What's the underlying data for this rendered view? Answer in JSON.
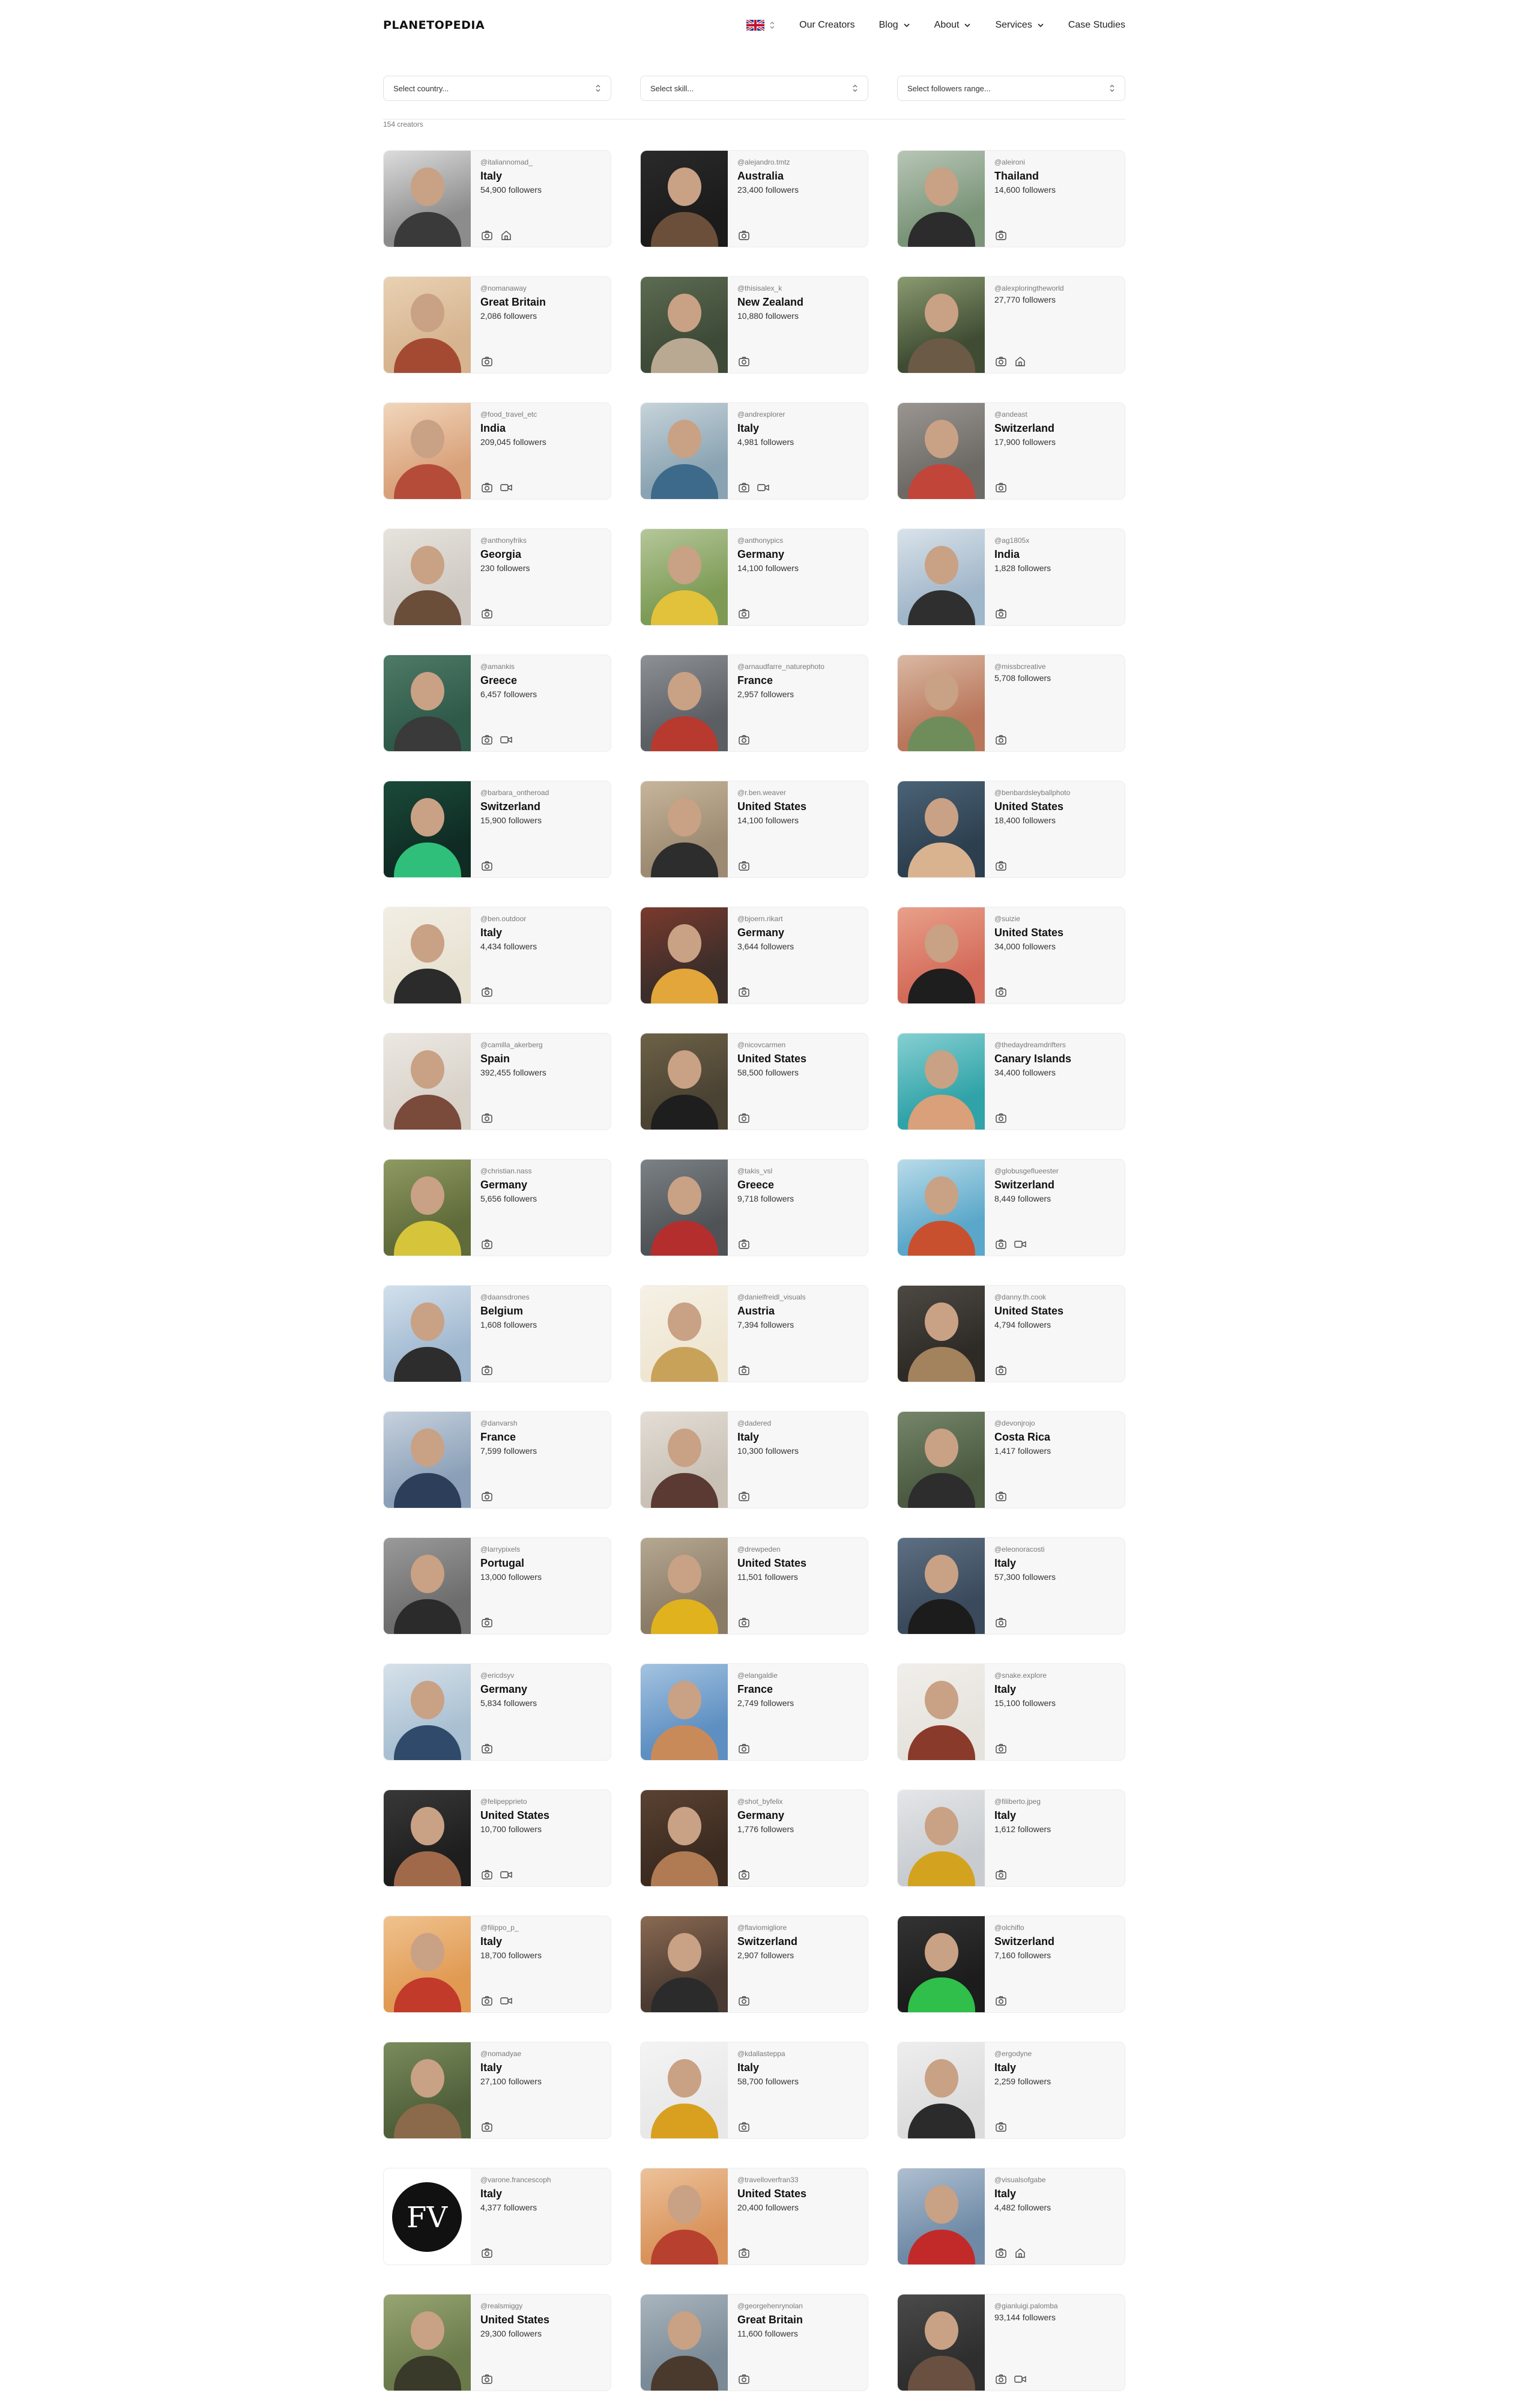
{
  "header": {
    "logo": "PLANETOPEDIA",
    "nav": [
      "Our Creators",
      "Blog",
      "About",
      "Services",
      "Case Studies"
    ]
  },
  "filters": {
    "country": "Select country...",
    "skill": "Select skill...",
    "followers": "Select followers range..."
  },
  "results_count": "154 creators",
  "creators": [
    {
      "handle": "@italiannomad_",
      "country": "Italy",
      "followers": "54,900 followers",
      "icons": [
        "camera-icon",
        "home-icon"
      ],
      "tones": [
        "#8c8c8c",
        "#3a3a3a",
        "#dcdcdc"
      ]
    },
    {
      "handle": "@alejandro.tmtz",
      "country": "Australia",
      "followers": "23,400 followers",
      "icons": [
        "camera-icon"
      ],
      "tones": [
        "#1b1b1b",
        "#6b4f3a",
        "#2a2a2a"
      ]
    },
    {
      "handle": "@aleironi",
      "country": "Thailand",
      "followers": "14,600 followers",
      "icons": [
        "camera-icon"
      ],
      "tones": [
        "#7a9478",
        "#2c2c2c",
        "#b7c6b6"
      ]
    },
    {
      "handle": "@nomanaway",
      "country": "Great Britain",
      "followers": "2,086 followers",
      "icons": [
        "camera-icon"
      ],
      "tones": [
        "#d6b48f",
        "#a54a32",
        "#e9d1b3"
      ]
    },
    {
      "handle": "@thisisalex_k",
      "country": "New Zealand",
      "followers": "10,880 followers",
      "icons": [
        "camera-icon"
      ],
      "tones": [
        "#3d4a37",
        "#b9a892",
        "#5c6b52"
      ]
    },
    {
      "handle": "@alexploringtheworld",
      "country": "",
      "followers": "27,770 followers",
      "icons": [
        "camera-icon",
        "home-icon"
      ],
      "tones": [
        "#3f4c33",
        "#6b5a45",
        "#8a9a70"
      ]
    },
    {
      "handle": "@food_travel_etc",
      "country": "India",
      "followers": "209,045 followers",
      "icons": [
        "camera-icon",
        "video-icon"
      ],
      "tones": [
        "#d9a17a",
        "#b54c3a",
        "#f1d6bb"
      ]
    },
    {
      "handle": "@andrexplorer",
      "country": "Italy",
      "followers": "4,981 followers",
      "icons": [
        "camera-icon",
        "video-icon"
      ],
      "tones": [
        "#8aa3b2",
        "#3d6a8a",
        "#c6d3da"
      ]
    },
    {
      "handle": "@andeast",
      "country": "Switzerland",
      "followers": "17,900 followers",
      "icons": [
        "camera-icon"
      ],
      "tones": [
        "#6d6a66",
        "#c2453a",
        "#9a9590"
      ]
    },
    {
      "handle": "@anthonyfriks",
      "country": "Georgia",
      "followers": "230 followers",
      "icons": [
        "camera-icon"
      ],
      "tones": [
        "#cfcac3",
        "#6a4e3a",
        "#e6e2dc"
      ]
    },
    {
      "handle": "@anthonypics",
      "country": "Germany",
      "followers": "14,100 followers",
      "icons": [
        "camera-icon"
      ],
      "tones": [
        "#7d9b55",
        "#e1c23a",
        "#b5c79a"
      ]
    },
    {
      "handle": "@ag1805x",
      "country": "India",
      "followers": "1,828 followers",
      "icons": [
        "camera-icon"
      ],
      "tones": [
        "#a0b6c9",
        "#2f2f2f",
        "#d9e2ea"
      ]
    },
    {
      "handle": "@amankis",
      "country": "Greece",
      "followers": "6,457 followers",
      "icons": [
        "camera-icon",
        "video-icon"
      ],
      "tones": [
        "#2f5a4a",
        "#3a3a3a",
        "#4e7a66"
      ]
    },
    {
      "handle": "@arnaudfarre_naturephoto",
      "country": "France",
      "followers": "2,957 followers",
      "icons": [
        "camera-icon"
      ],
      "tones": [
        "#5b5f63",
        "#b8392e",
        "#8d9196"
      ]
    },
    {
      "handle": "@missbcreative",
      "country": "",
      "followers": "5,708 followers",
      "icons": [
        "camera-icon"
      ],
      "tones": [
        "#b9765a",
        "#6f8d5a",
        "#d9b8a3"
      ]
    },
    {
      "handle": "@barbara_ontheroad",
      "country": "Switzerland",
      "followers": "15,900 followers",
      "icons": [
        "camera-icon"
      ],
      "tones": [
        "#0f2b23",
        "#2fbf7a",
        "#1b4a3a"
      ]
    },
    {
      "handle": "@r.ben.weaver",
      "country": "United States",
      "followers": "14,100 followers",
      "icons": [
        "camera-icon"
      ],
      "tones": [
        "#9c8a72",
        "#2d2d2d",
        "#c7b59b"
      ]
    },
    {
      "handle": "@benbardsleyballphoto",
      "country": "United States",
      "followers": "18,400 followers",
      "icons": [
        "camera-icon"
      ],
      "tones": [
        "#2c3f4f",
        "#d9b38f",
        "#4b6376"
      ]
    },
    {
      "handle": "@ben.outdoor",
      "country": "Italy",
      "followers": "4,434 followers",
      "icons": [
        "camera-icon"
      ],
      "tones": [
        "#e8e2d2",
        "#2b2b2b",
        "#f2eee4"
      ]
    },
    {
      "handle": "@bjoern.rikart",
      "country": "Germany",
      "followers": "3,644 followers",
      "icons": [
        "camera-icon"
      ],
      "tones": [
        "#3a2d2a",
        "#e2a63a",
        "#7a3a2e"
      ]
    },
    {
      "handle": "@suizie",
      "country": "United States",
      "followers": "34,000 followers",
      "icons": [
        "camera-icon"
      ],
      "tones": [
        "#d46b5a",
        "#1e1e1e",
        "#e8a08a"
      ]
    },
    {
      "handle": "@camilla_akerberg",
      "country": "Spain",
      "followers": "392,455 followers",
      "icons": [
        "camera-icon"
      ],
      "tones": [
        "#d8d2c9",
        "#7a4a3a",
        "#ece8e2"
      ]
    },
    {
      "handle": "@nicovcarmen",
      "country": "United States",
      "followers": "58,500 followers",
      "icons": [
        "camera-icon"
      ],
      "tones": [
        "#4a4232",
        "#1e1e1e",
        "#6d6248"
      ]
    },
    {
      "handle": "@thedaydreamdrifters",
      "country": "Canary Islands",
      "followers": "34,400 followers",
      "icons": [
        "camera-icon"
      ],
      "tones": [
        "#2fa3a8",
        "#d9a07a",
        "#86cfd1"
      ]
    },
    {
      "handle": "@christian.nass",
      "country": "Germany",
      "followers": "5,656 followers",
      "icons": [
        "camera-icon"
      ],
      "tones": [
        "#5f6b3a",
        "#d6c43a",
        "#8f9a62"
      ]
    },
    {
      "handle": "@takis_vsl",
      "country": "Greece",
      "followers": "9,718 followers",
      "icons": [
        "camera-icon"
      ],
      "tones": [
        "#4f5356",
        "#b52e2e",
        "#7c8185"
      ]
    },
    {
      "handle": "@globusgeflueester",
      "country": "Switzerland",
      "followers": "8,449 followers",
      "icons": [
        "camera-icon",
        "video-icon"
      ],
      "tones": [
        "#5aa7c9",
        "#c9502e",
        "#b9dbe9"
      ]
    },
    {
      "handle": "@daansdrones",
      "country": "Belgium",
      "followers": "1,608 followers",
      "icons": [
        "camera-icon"
      ],
      "tones": [
        "#9fb7cf",
        "#2d2d2d",
        "#d2e0ec"
      ]
    },
    {
      "handle": "@danielfreidl_visuals",
      "country": "Austria",
      "followers": "7,394 followers",
      "icons": [
        "camera-icon"
      ],
      "tones": [
        "#efe6d2",
        "#c9a25a",
        "#f6f1e6"
      ]
    },
    {
      "handle": "@danny.th.cook",
      "country": "United States",
      "followers": "4,794 followers",
      "icons": [
        "camera-icon"
      ],
      "tones": [
        "#2e2b27",
        "#a3825e",
        "#4d4842"
      ]
    },
    {
      "handle": "@danvarsh",
      "country": "France",
      "followers": "7,599 followers",
      "icons": [
        "camera-icon"
      ],
      "tones": [
        "#8ba0b8",
        "#2c3e5a",
        "#c6d1dd"
      ]
    },
    {
      "handle": "@dadered",
      "country": "Italy",
      "followers": "10,300 followers",
      "icons": [
        "camera-icon"
      ],
      "tones": [
        "#c9c1b6",
        "#5a3a32",
        "#e3ddd5"
      ]
    },
    {
      "handle": "@devonjrojo",
      "country": "Costa Rica",
      "followers": "1,417 followers",
      "icons": [
        "camera-icon"
      ],
      "tones": [
        "#4b5a40",
        "#2d2d2d",
        "#75866a"
      ]
    },
    {
      "handle": "@larrypixels",
      "country": "Portugal",
      "followers": "13,000 followers",
      "icons": [
        "camera-icon"
      ],
      "tones": [
        "#6d6d6d",
        "#2b2b2b",
        "#9a9a9a"
      ]
    },
    {
      "handle": "@drewpeden",
      "country": "United States",
      "followers": "11,501 followers",
      "icons": [
        "camera-icon"
      ],
      "tones": [
        "#8a7b66",
        "#e0b21e",
        "#b5a891"
      ]
    },
    {
      "handle": "@eleonoracosti",
      "country": "Italy",
      "followers": "57,300 followers",
      "icons": [
        "camera-icon"
      ],
      "tones": [
        "#3a4a5c",
        "#1c1c1c",
        "#5d6f82"
      ]
    },
    {
      "handle": "@ericdsyv",
      "country": "Germany",
      "followers": "5,834 followers",
      "icons": [
        "camera-icon"
      ],
      "tones": [
        "#a9c0d2",
        "#2f4a6a",
        "#d6e1ea"
      ]
    },
    {
      "handle": "@elangaldie",
      "country": "France",
      "followers": "2,749 followers",
      "icons": [
        "camera-icon"
      ],
      "tones": [
        "#5d8fc2",
        "#c98a5a",
        "#a4c3e0"
      ]
    },
    {
      "handle": "@snake.explore",
      "country": "Italy",
      "followers": "15,100 followers",
      "icons": [
        "camera-icon"
      ],
      "tones": [
        "#e6e3dd",
        "#8a3a2a",
        "#f1efeb"
      ]
    },
    {
      "handle": "@felipepprieto",
      "country": "United States",
      "followers": "10,700 followers",
      "icons": [
        "camera-icon",
        "video-icon"
      ],
      "tones": [
        "#1e1e1e",
        "#a06a4a",
        "#383838"
      ]
    },
    {
      "handle": "@shot_byfelix",
      "country": "Germany",
      "followers": "1,776 followers",
      "icons": [
        "camera-icon"
      ],
      "tones": [
        "#3a2a20",
        "#b07a52",
        "#5a4232"
      ]
    },
    {
      "handle": "@filiberto.jpeg",
      "country": "Italy",
      "followers": "1,612 followers",
      "icons": [
        "camera-icon"
      ],
      "tones": [
        "#c8ccd0",
        "#d3a320",
        "#e4e6e8"
      ]
    },
    {
      "handle": "@filippo_p_",
      "country": "Italy",
      "followers": "18,700 followers",
      "icons": [
        "camera-icon",
        "video-icon"
      ],
      "tones": [
        "#e09a52",
        "#c23a2a",
        "#f0c28f"
      ]
    },
    {
      "handle": "@flaviomigliore",
      "country": "Switzerland",
      "followers": "2,907 followers",
      "icons": [
        "camera-icon"
      ],
      "tones": [
        "#4a3a32",
        "#2b2b2b",
        "#8a6a52"
      ]
    },
    {
      "handle": "@olchiflo",
      "country": "Switzerland",
      "followers": "7,160 followers",
      "icons": [
        "camera-icon"
      ],
      "tones": [
        "#1c1c1c",
        "#2fbf4a",
        "#333333"
      ]
    },
    {
      "handle": "@nomadyae",
      "country": "Italy",
      "followers": "27,100 followers",
      "icons": [
        "camera-icon"
      ],
      "tones": [
        "#4f5f3a",
        "#8a6a4a",
        "#7a8c5c"
      ]
    },
    {
      "handle": "@kdallasteppa",
      "country": "Italy",
      "followers": "58,700 followers",
      "icons": [
        "camera-icon"
      ],
      "tones": [
        "#e8e8e8",
        "#d9a020",
        "#f4f4f4"
      ]
    },
    {
      "handle": "@ergodyne",
      "country": "Italy",
      "followers": "2,259 followers",
      "icons": [
        "camera-icon"
      ],
      "tones": [
        "#dcdcdc",
        "#2b2b2b",
        "#eeeeee"
      ]
    },
    {
      "handle": "@varone.francescoph",
      "country": "Italy",
      "followers": "4,377 followers",
      "icons": [
        "camera-icon"
      ],
      "tones": [
        "#ffffff",
        "#111111",
        "#ffffff"
      ],
      "logo": true
    },
    {
      "handle": "@travelloverfran33",
      "country": "United States",
      "followers": "20,400 followers",
      "icons": [
        "camera-icon"
      ],
      "tones": [
        "#d9935a",
        "#b8402e",
        "#ecc29a"
      ]
    },
    {
      "handle": "@visualsofgabe",
      "country": "Italy",
      "followers": "4,482 followers",
      "icons": [
        "camera-icon",
        "home-icon"
      ],
      "tones": [
        "#6f8aa6",
        "#c22a2a",
        "#aebfd0"
      ]
    },
    {
      "handle": "@realsmiggy",
      "country": "United States",
      "followers": "29,300 followers",
      "icons": [
        "camera-icon"
      ],
      "tones": [
        "#6b7a4a",
        "#3a3a2a",
        "#97a574"
      ]
    },
    {
      "handle": "@georgehenrynolan",
      "country": "Great Britain",
      "followers": "11,600 followers",
      "icons": [
        "camera-icon"
      ],
      "tones": [
        "#7a8a96",
        "#4a3a2e",
        "#a9b5be"
      ]
    },
    {
      "handle": "@gianluigi.palomba",
      "country": "",
      "followers": "93,144 followers",
      "icons": [
        "camera-icon",
        "video-icon"
      ],
      "tones": [
        "#2e2e2e",
        "#6a5040",
        "#4a4a4a"
      ]
    }
  ]
}
